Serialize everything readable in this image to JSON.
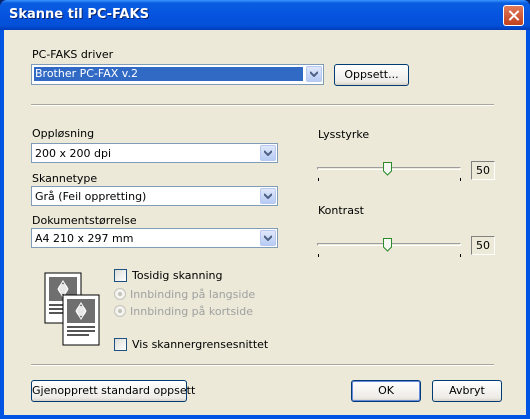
{
  "window": {
    "title": "Skanne til PC-FAKS"
  },
  "driver": {
    "label": "PC-FAKS driver",
    "value": "Brother PC-FAX v.2",
    "setup_button": "Oppsett..."
  },
  "resolution": {
    "label": "Oppløsning",
    "value": "200 x 200 dpi"
  },
  "scan_type": {
    "label": "Skannetype",
    "value": "Grå (Feil oppretting)"
  },
  "doc_size": {
    "label": "Dokumentstørrelse",
    "value": "A4 210 x 297 mm"
  },
  "brightness": {
    "label": "Lysstyrke",
    "value": "50"
  },
  "contrast": {
    "label": "Kontrast",
    "value": "50"
  },
  "duplex": {
    "label": "Tosidig skanning",
    "checked": false,
    "options": [
      "Innbinding på langside",
      "Innbinding på kortside"
    ],
    "selected_index": 0
  },
  "show_interface": {
    "label": "Vis skannergrensesnittet",
    "checked": false
  },
  "footer": {
    "restore_button": "Gjenopprett standard oppsett",
    "ok_button": "OK",
    "cancel_button": "Avbryt"
  },
  "colors": {
    "titlebar": "#0054e3",
    "dialog_bg": "#ece9d8",
    "selection": "#316ac5"
  }
}
